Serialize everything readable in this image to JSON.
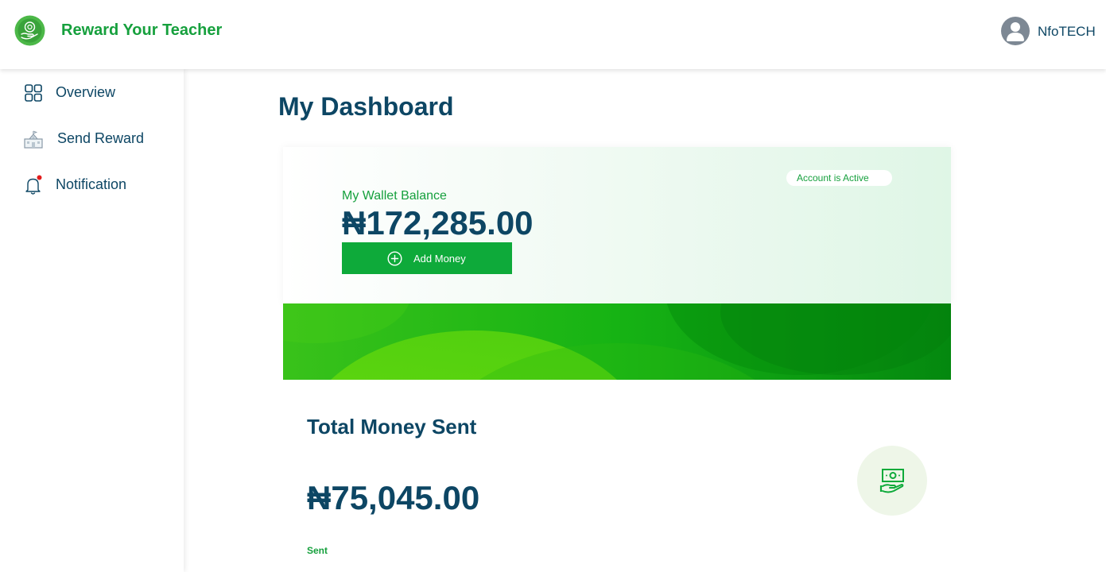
{
  "header": {
    "brand": "Reward Your Teacher",
    "username": "NfoTECH"
  },
  "sidebar": {
    "items": [
      {
        "label": "Overview",
        "icon": "grid-icon"
      },
      {
        "label": "Send Reward",
        "icon": "school-building-icon"
      },
      {
        "label": "Notification",
        "icon": "bell-icon",
        "has_unread_dot": true
      }
    ]
  },
  "main": {
    "title": "My Dashboard",
    "wallet": {
      "status": "Account is Active",
      "label": "My Wallet Balance",
      "balance": "₦172,285.00",
      "add_money_label": "Add Money"
    },
    "total_sent": {
      "title": "Total Money Sent",
      "amount": "₦75,045.00",
      "caption": "Sent",
      "icon": "cash-hand-icon"
    }
  },
  "colors": {
    "brand_green": "#16a03d",
    "button_green": "#0eaa3a",
    "navy_text": "#0d4664",
    "notification_dot": "#e21b1b"
  }
}
